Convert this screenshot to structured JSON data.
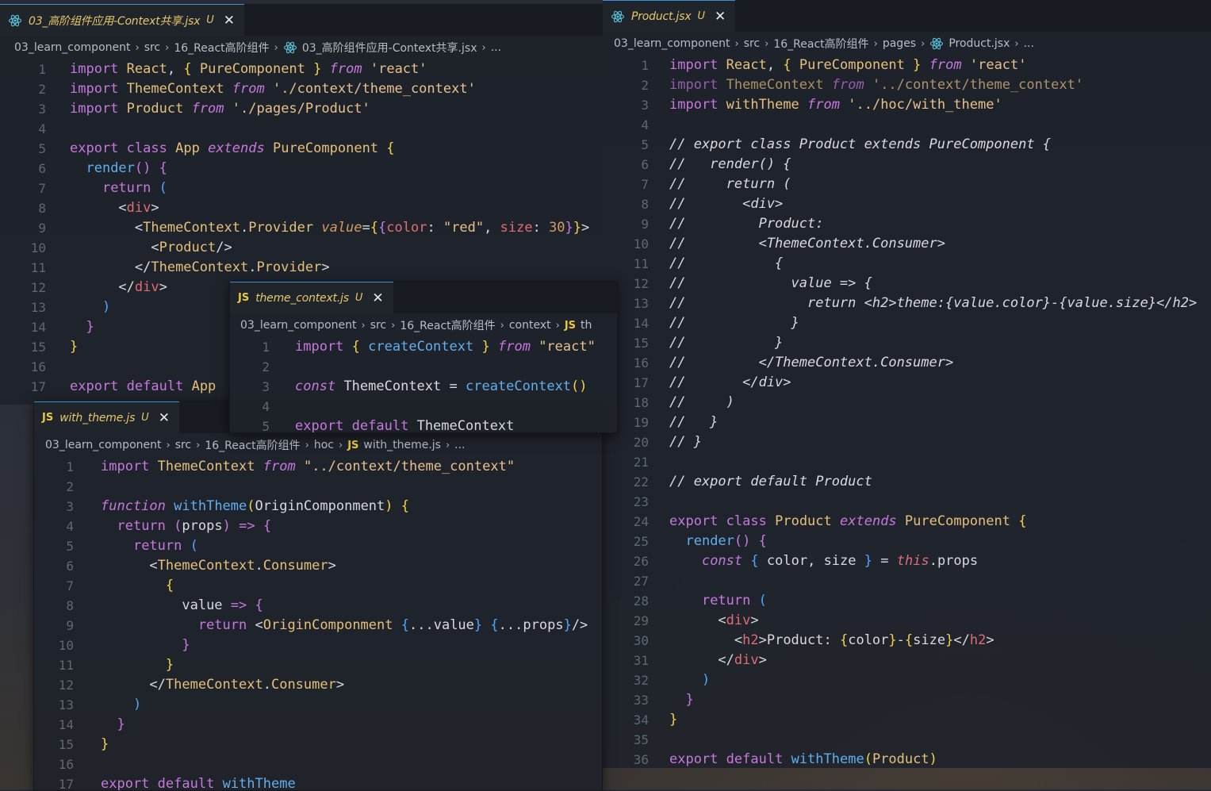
{
  "editors": {
    "app": {
      "tab": {
        "name": "03_高阶组件应用-Context共享.jsx",
        "status": "U",
        "close": "✕"
      },
      "breadcrumb": [
        "03_learn_component",
        "src",
        "16_React高阶组件",
        "03_高阶组件应用-Context共享.jsx",
        "..."
      ],
      "lines": [
        "1",
        "2",
        "3",
        "4",
        "5",
        "6",
        "7",
        "8",
        "9",
        "10",
        "11",
        "12",
        "13",
        "14",
        "15",
        "16",
        "17"
      ]
    },
    "theme_context": {
      "tab": {
        "name": "theme_context.js",
        "status": "U",
        "close": "✕"
      },
      "breadcrumb": [
        "03_learn_component",
        "src",
        "16_React高阶组件",
        "context",
        "th"
      ],
      "lines": [
        "1",
        "2",
        "3",
        "4",
        "5"
      ]
    },
    "with_theme": {
      "tab": {
        "name": "with_theme.js",
        "status": "U",
        "close": "✕"
      },
      "breadcrumb": [
        "03_learn_component",
        "src",
        "16_React高阶组件",
        "hoc",
        "with_theme.js",
        "..."
      ],
      "lines": [
        "1",
        "2",
        "3",
        "4",
        "5",
        "6",
        "7",
        "8",
        "9",
        "10",
        "11",
        "12",
        "13",
        "14",
        "15",
        "16",
        "17"
      ]
    },
    "product": {
      "tab": {
        "name": "Product.jsx",
        "status": "U",
        "close": "✕"
      },
      "breadcrumb": [
        "03_learn_component",
        "src",
        "16_React高阶组件",
        "pages",
        "Product.jsx",
        "..."
      ],
      "lines": [
        "1",
        "2",
        "3",
        "4",
        "5",
        "6",
        "7",
        "8",
        "9",
        "10",
        "11",
        "12",
        "13",
        "14",
        "15",
        "16",
        "17",
        "18",
        "19",
        "20",
        "21",
        "22",
        "23",
        "24",
        "25",
        "26",
        "27",
        "28",
        "29",
        "30",
        "31",
        "32",
        "33",
        "34",
        "35",
        "36"
      ]
    }
  },
  "icons": {
    "react": "react-icon",
    "js": "JS",
    "chevron": "chevron-right-icon"
  },
  "colors": {
    "keyword": "#c678dd",
    "type": "#e5c07b",
    "string": "#e8c08c",
    "tag": "#e06c75",
    "comment": "#6d7380",
    "accent": "#3a8fd6"
  }
}
